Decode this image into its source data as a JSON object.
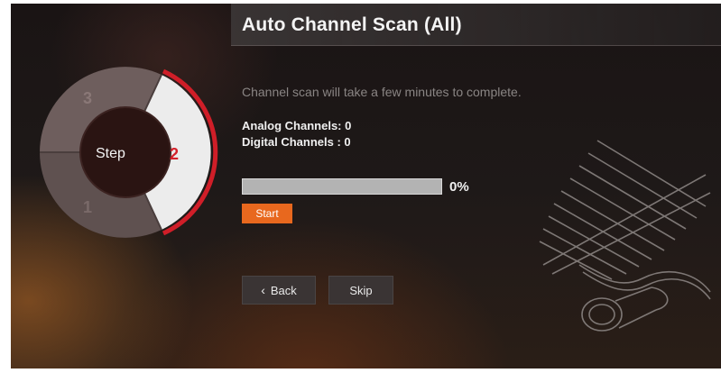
{
  "header": {
    "title": "Auto Channel Scan (All)"
  },
  "wizard": {
    "center_label": "Step",
    "steps": [
      "1",
      "2",
      "3"
    ],
    "current_step": "2"
  },
  "scan": {
    "description": "Channel scan will take a few minutes to complete.",
    "analog_label": "Analog Channels:",
    "analog_value": "0",
    "digital_label": "Digital Channels :",
    "digital_value": "0",
    "progress_value": 0,
    "progress_text": "0%",
    "start_label": "Start"
  },
  "nav": {
    "back_label": "Back",
    "skip_label": "Skip"
  },
  "colors": {
    "accent": "#e8681e",
    "step_active": "#d4202a"
  }
}
